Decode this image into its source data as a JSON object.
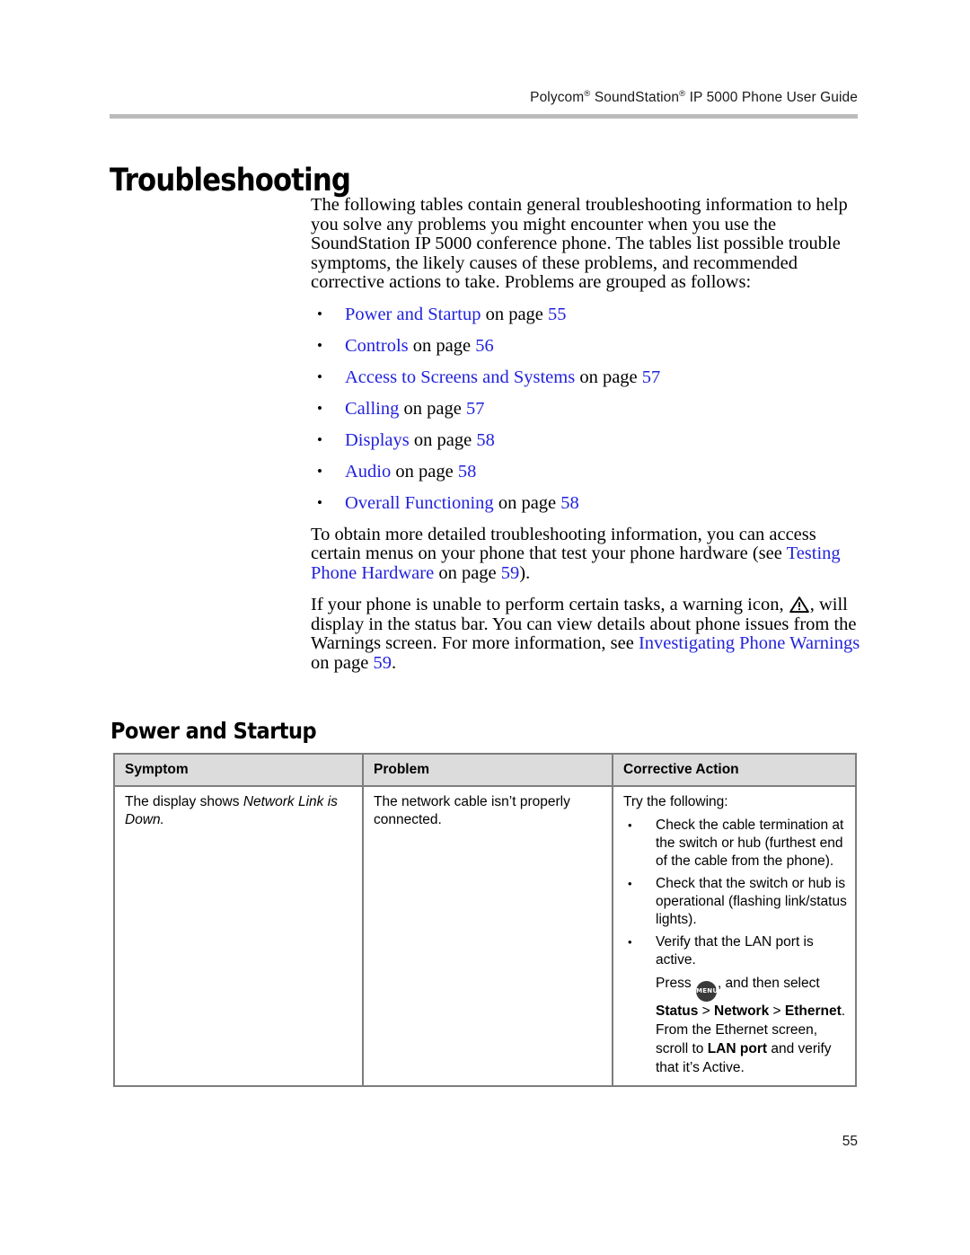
{
  "header": {
    "brand": "Polycom",
    "product": "SoundStation",
    "title_tail": " IP 5000 Phone User Guide",
    "registered_mark": "®"
  },
  "chapter": {
    "title": "Troubleshooting"
  },
  "intro": {
    "paragraph": "The following tables contain general troubleshooting information to help you solve any problems you might encounter when you use the SoundStation IP 5000 conference phone. The tables list possible trouble symptoms, the likely causes of these problems, and recommended corrective actions to take. Problems are grouped as follows:"
  },
  "xref_list": [
    {
      "bullet": "•",
      "link": "Power and Startup",
      "middle": " on page ",
      "page": "55"
    },
    {
      "bullet": "•",
      "link": "Controls",
      "middle": " on page ",
      "page": "56"
    },
    {
      "bullet": "•",
      "link": "Access to Screens and Systems",
      "middle": " on page ",
      "page": "57"
    },
    {
      "bullet": "•",
      "link": "Calling",
      "middle": " on page ",
      "page": "57"
    },
    {
      "bullet": "•",
      "link": "Displays",
      "middle": " on page ",
      "page": "58"
    },
    {
      "bullet": "•",
      "link": "Audio",
      "middle": " on page ",
      "page": "58"
    },
    {
      "bullet": "•",
      "link": "Overall Functioning",
      "middle": " on page ",
      "page": "58"
    }
  ],
  "para_testing": {
    "part1": "To obtain more detailed troubleshooting information, you can access certain menus on your phone that test your phone hardware (see ",
    "link": "Testing Phone Hardware",
    "part2": " on page ",
    "page": "59",
    "part3": ")."
  },
  "para_warning": {
    "part1": "If your phone is unable to perform certain tasks, a warning icon, ",
    "icon": "warning-triangle-icon",
    "part2": ", will display in the status bar. You can view details about phone issues from the Warnings screen. For more information, see ",
    "link": "Investigating Phone Warnings",
    "part3": " on page ",
    "page": "59",
    "part4": "."
  },
  "section": {
    "heading": "Power and Startup"
  },
  "table": {
    "headers": [
      "Symptom",
      "Problem",
      "Corrective Action"
    ],
    "rows": [
      {
        "symptom_pre": "The display shows ",
        "symptom_italic": "Network Link is Down",
        "symptom_post": ".",
        "problem": "The network cable isn’t properly connected.",
        "action_lead": "Try the following:",
        "action_bullets": [
          {
            "bullet": "•",
            "text": "Check the cable termination at the switch or hub (furthest end of the cable from the phone)."
          },
          {
            "bullet": "•",
            "text": "Check that the switch or hub is operational (flashing link/status lights)."
          },
          {
            "bullet": "•",
            "text": "Verify that the LAN port is active."
          }
        ],
        "action_sub": {
          "p1": "Press ",
          "key": "MENU",
          "p2": ", and then select ",
          "b1": "Status",
          "p3": " > ",
          "b2": "Network",
          "p4": " > ",
          "b3": "Ethernet",
          "p5": ". From the Ethernet screen, scroll to ",
          "b4": "LAN port",
          "p6": " and verify that it’s Active."
        }
      }
    ]
  },
  "folio": {
    "page_number": "55"
  },
  "colors": {
    "link": "#2222dd",
    "header_rule": "#bcbcbc",
    "table_border": "#7d7d7d",
    "table_header_bg": "#dcdcdc",
    "menu_key_bg": "#3a3a3a"
  }
}
